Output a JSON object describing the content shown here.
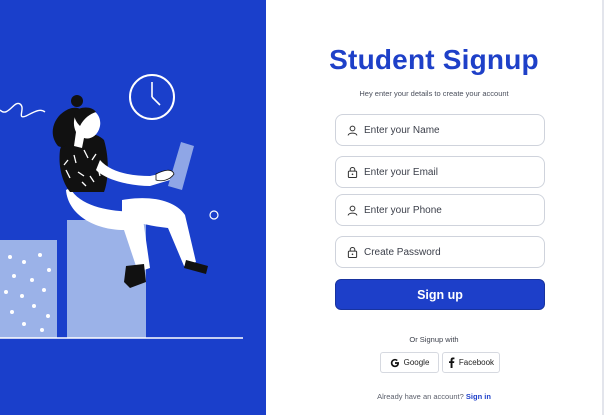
{
  "form": {
    "title": "Student Signup",
    "subtitle": "Hey enter your details to create your account",
    "fields": [
      {
        "placeholder": "Enter your Name",
        "icon": "user-icon"
      },
      {
        "placeholder": "Enter your Email",
        "icon": "lock-icon"
      },
      {
        "placeholder": "Enter your Phone",
        "icon": "user-icon"
      },
      {
        "placeholder": "Create Password",
        "icon": "lock-icon"
      }
    ],
    "submit_label": "Sign up",
    "or_text": "Or Signup with",
    "social": {
      "google_label": "Google",
      "facebook_label": "Facebook"
    },
    "footer": {
      "prompt": "Already have an account?",
      "link_label": "Sign in"
    }
  },
  "colors": {
    "brand_blue": "#1e40c8",
    "button_blue": "#1d3fc9",
    "panel_blue": "#1a3fcb",
    "box_light": "#9bb2e8"
  }
}
